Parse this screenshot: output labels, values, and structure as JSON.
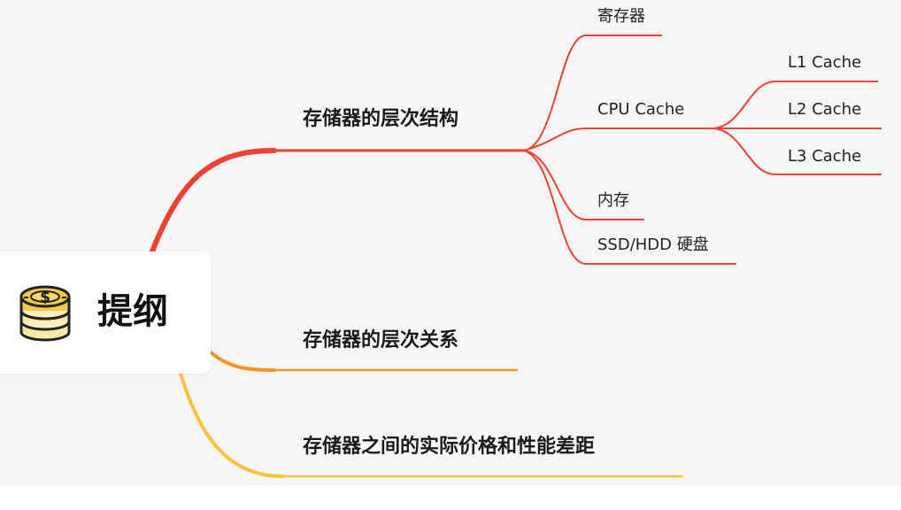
{
  "root": {
    "label": "提纲",
    "icon": "coin-stack-icon"
  },
  "branches": [
    {
      "label": "存储器的层次结构",
      "color": "#ef4136",
      "children": [
        {
          "label": "寄存器"
        },
        {
          "label": "CPU Cache",
          "children": [
            {
              "label": "L1 Cache"
            },
            {
              "label": "L2 Cache"
            },
            {
              "label": "L3 Cache"
            }
          ]
        },
        {
          "label": "内存"
        },
        {
          "label": "SSD/HDD 硬盘"
        }
      ]
    },
    {
      "label": "存储器的层次关系",
      "color": "#f7941d"
    },
    {
      "label": "存储器之间的实际价格和性能差距",
      "color": "#f9c23c"
    }
  ]
}
